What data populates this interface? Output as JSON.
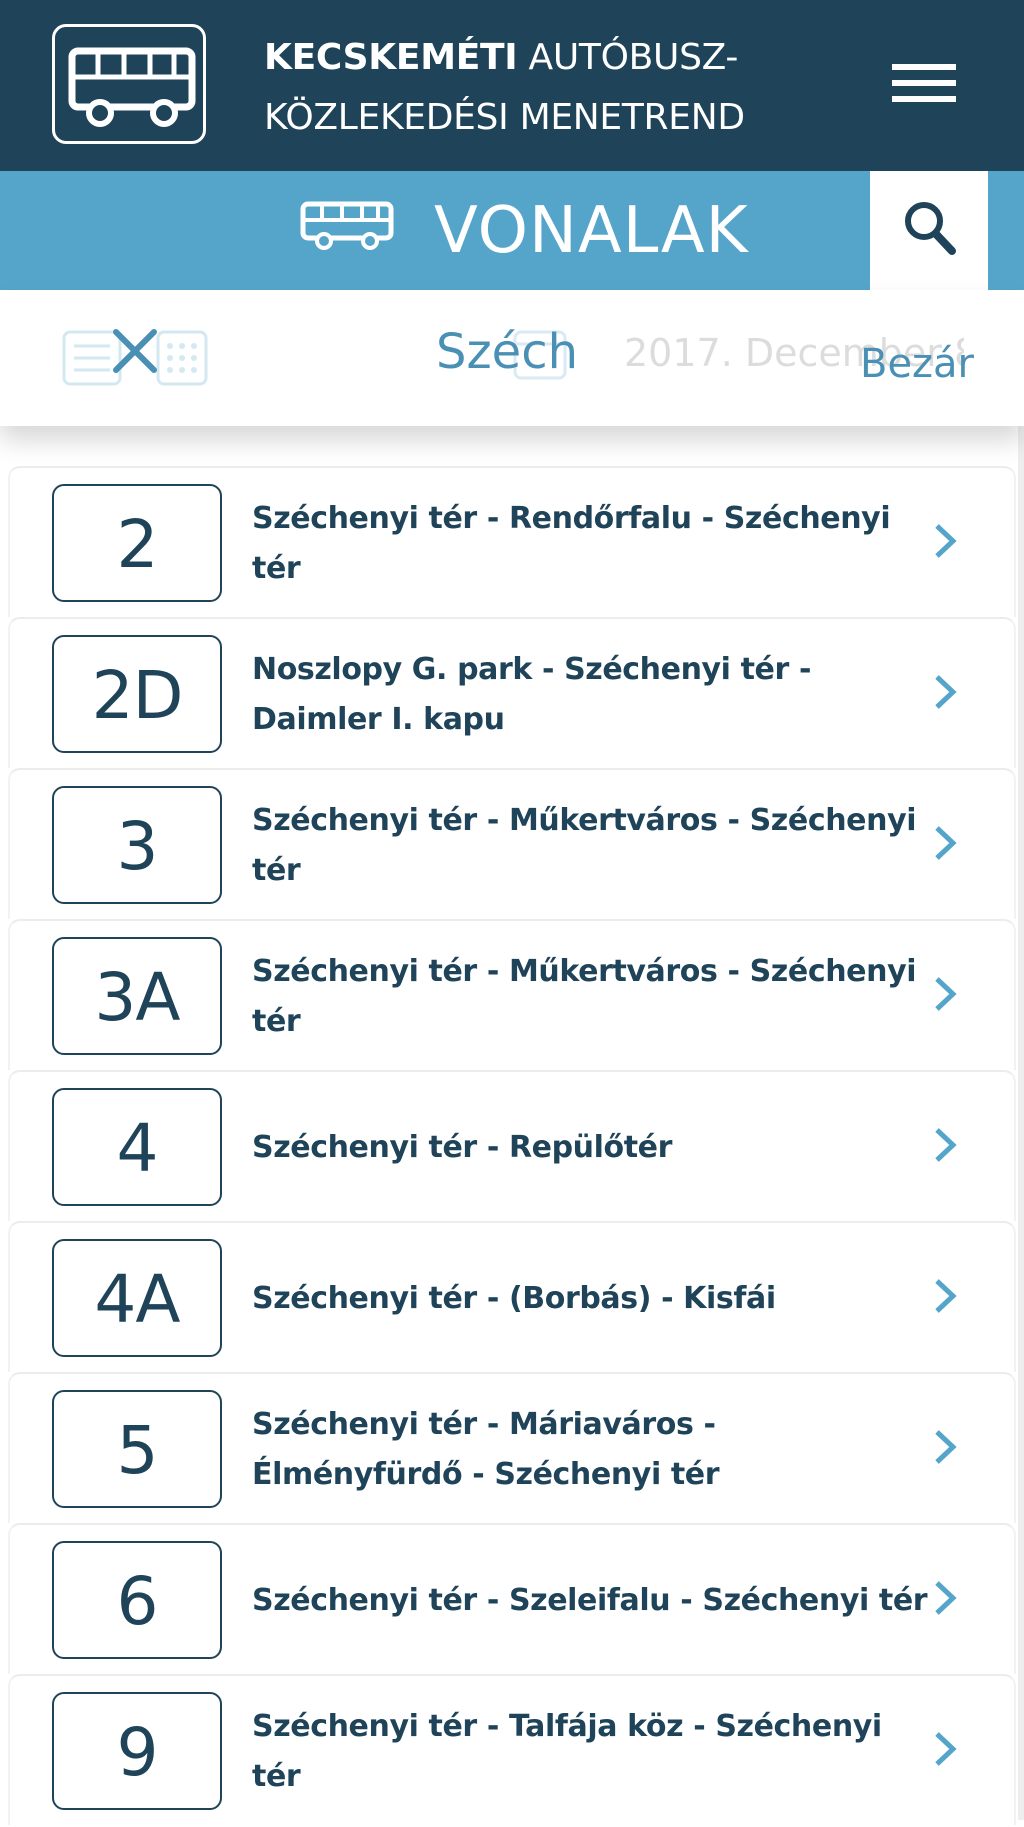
{
  "header": {
    "title_bold": "KECSKEMÉTI",
    "title_rest_line1": " AUTÓBUSZ-",
    "title_line2": "KÖZLEKEDÉSI MENETREND",
    "logo_icon": "bus-icon",
    "menu_icon": "hamburger-menu-icon"
  },
  "section": {
    "title": "VONALAK",
    "icon": "bus-icon",
    "search_icon": "search-icon"
  },
  "search": {
    "value": "Széch",
    "date_hint": "2017. December 8.",
    "close_label": "Bezár",
    "clear_icon": "close-icon"
  },
  "colors": {
    "header_bg": "#1f4358",
    "section_bg": "#55a5cb",
    "accent": "#4a90b5",
    "text_dark": "#1f4358"
  },
  "routes": [
    {
      "number": "2",
      "name": "Széchenyi tér - Rendőrfalu - Széchenyi tér"
    },
    {
      "number": "2D",
      "name": "Noszlopy G. park - Széchenyi tér - Daimler I. kapu"
    },
    {
      "number": "3",
      "name": "Széchenyi tér - Műkertváros - Széchenyi tér"
    },
    {
      "number": "3A",
      "name": "Széchenyi tér - Műkertváros - Széchenyi tér"
    },
    {
      "number": "4",
      "name": "Széchenyi tér - Repülőtér"
    },
    {
      "number": "4A",
      "name": "Széchenyi tér - (Borbás) - Kisfái"
    },
    {
      "number": "5",
      "name": "Széchenyi tér - Máriaváros - Élményfürdő - Széchenyi tér"
    },
    {
      "number": "6",
      "name": "Széchenyi tér - Szeleifalu - Széchenyi tér"
    },
    {
      "number": "9",
      "name": "Széchenyi tér - Talfája köz - Széchenyi tér"
    }
  ]
}
